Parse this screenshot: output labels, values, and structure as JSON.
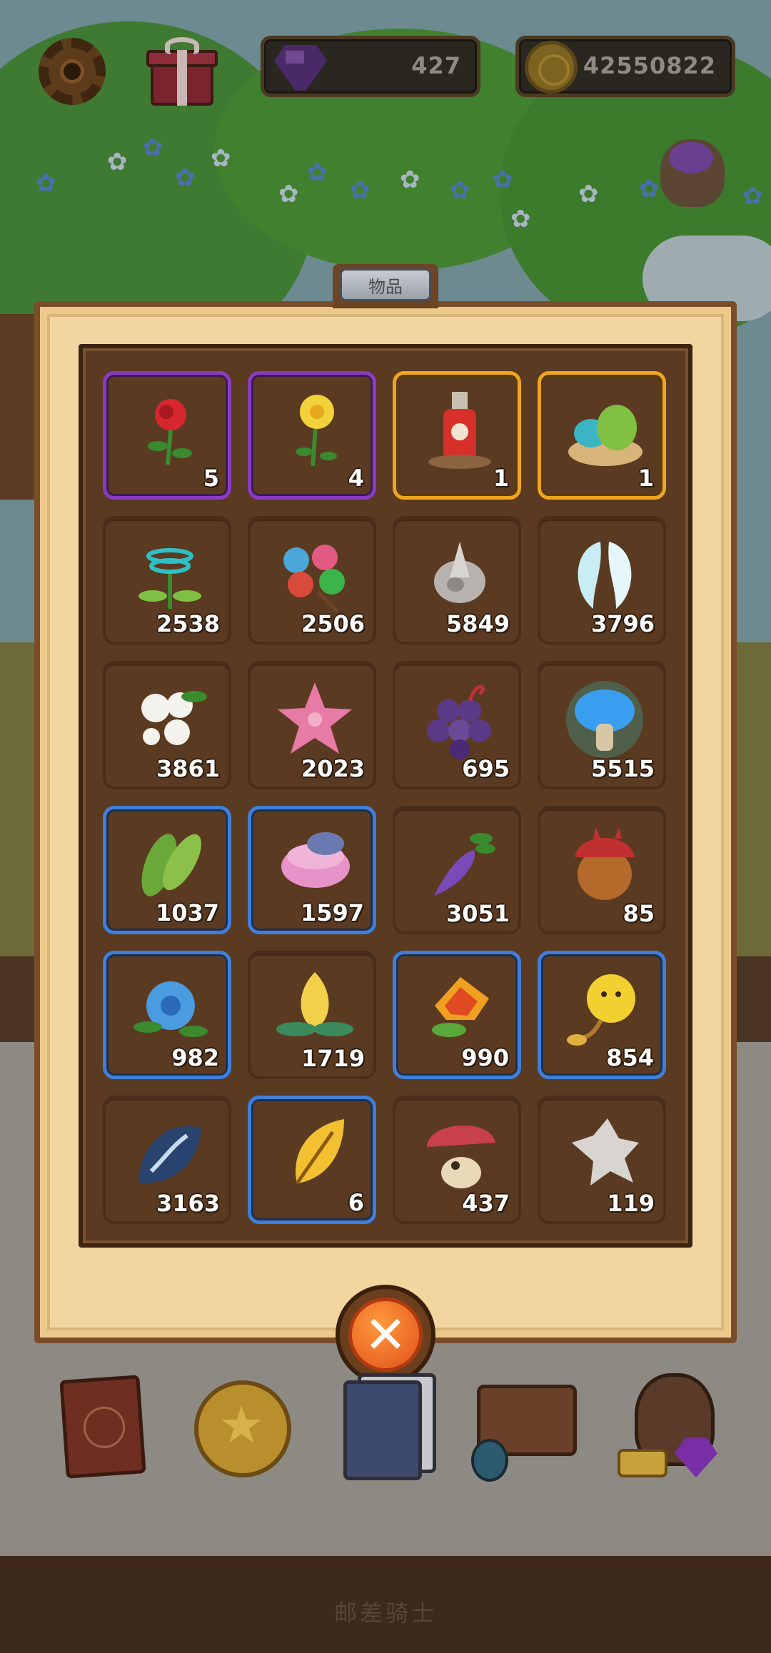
{
  "hud": {
    "gems": "427",
    "coins": "42550822"
  },
  "panel": {
    "title": "物品"
  },
  "items": [
    {
      "count": "5",
      "rarity": "purple",
      "icon": "red-rose-icon"
    },
    {
      "count": "4",
      "rarity": "purple",
      "icon": "daffodil-icon"
    },
    {
      "count": "1",
      "rarity": "gold",
      "icon": "poison-bottle-icon"
    },
    {
      "count": "1",
      "rarity": "gold",
      "icon": "dragon-eggs-nest-icon"
    },
    {
      "count": "2538",
      "rarity": "none",
      "icon": "spiral-herb-icon"
    },
    {
      "count": "2506",
      "rarity": "none",
      "icon": "berry-cluster-icon"
    },
    {
      "count": "5849",
      "rarity": "none",
      "icon": "silver-shell-icon"
    },
    {
      "count": "3796",
      "rarity": "none",
      "icon": "angel-wings-icon"
    },
    {
      "count": "3861",
      "rarity": "none",
      "icon": "cotton-flower-icon"
    },
    {
      "count": "2023",
      "rarity": "none",
      "icon": "pink-starfish-icon"
    },
    {
      "count": "695",
      "rarity": "none",
      "icon": "purple-grapes-icon"
    },
    {
      "count": "5515",
      "rarity": "none",
      "icon": "glowing-mushroom-icon"
    },
    {
      "count": "1037",
      "rarity": "blue",
      "icon": "green-leaves-icon"
    },
    {
      "count": "1597",
      "rarity": "blue",
      "icon": "pink-clam-icon"
    },
    {
      "count": "3051",
      "rarity": "none",
      "icon": "purple-radish-icon"
    },
    {
      "count": "85",
      "rarity": "none",
      "icon": "spiked-acorn-icon"
    },
    {
      "count": "982",
      "rarity": "blue",
      "icon": "blue-flower-icon"
    },
    {
      "count": "1719",
      "rarity": "none",
      "icon": "golden-lotus-icon"
    },
    {
      "count": "990",
      "rarity": "blue",
      "icon": "fire-flower-icon"
    },
    {
      "count": "854",
      "rarity": "blue",
      "icon": "yellow-puffball-icon"
    },
    {
      "count": "3163",
      "rarity": "none",
      "icon": "dark-leaf-icon"
    },
    {
      "count": "6",
      "rarity": "blue",
      "icon": "golden-leaf-icon"
    },
    {
      "count": "437",
      "rarity": "none",
      "icon": "red-cap-mushroom-icon"
    },
    {
      "count": "119",
      "rarity": "none",
      "icon": "fur-pelt-icon"
    }
  ],
  "footer": {
    "title": "邮差骑士"
  },
  "colors": {
    "purple_border": "#8a3bc5",
    "gold_border": "#f0a51e",
    "blue_border": "#3f7fd9",
    "panel_bg": "#f2d6a0",
    "slot_bg": "#5b3a22"
  }
}
